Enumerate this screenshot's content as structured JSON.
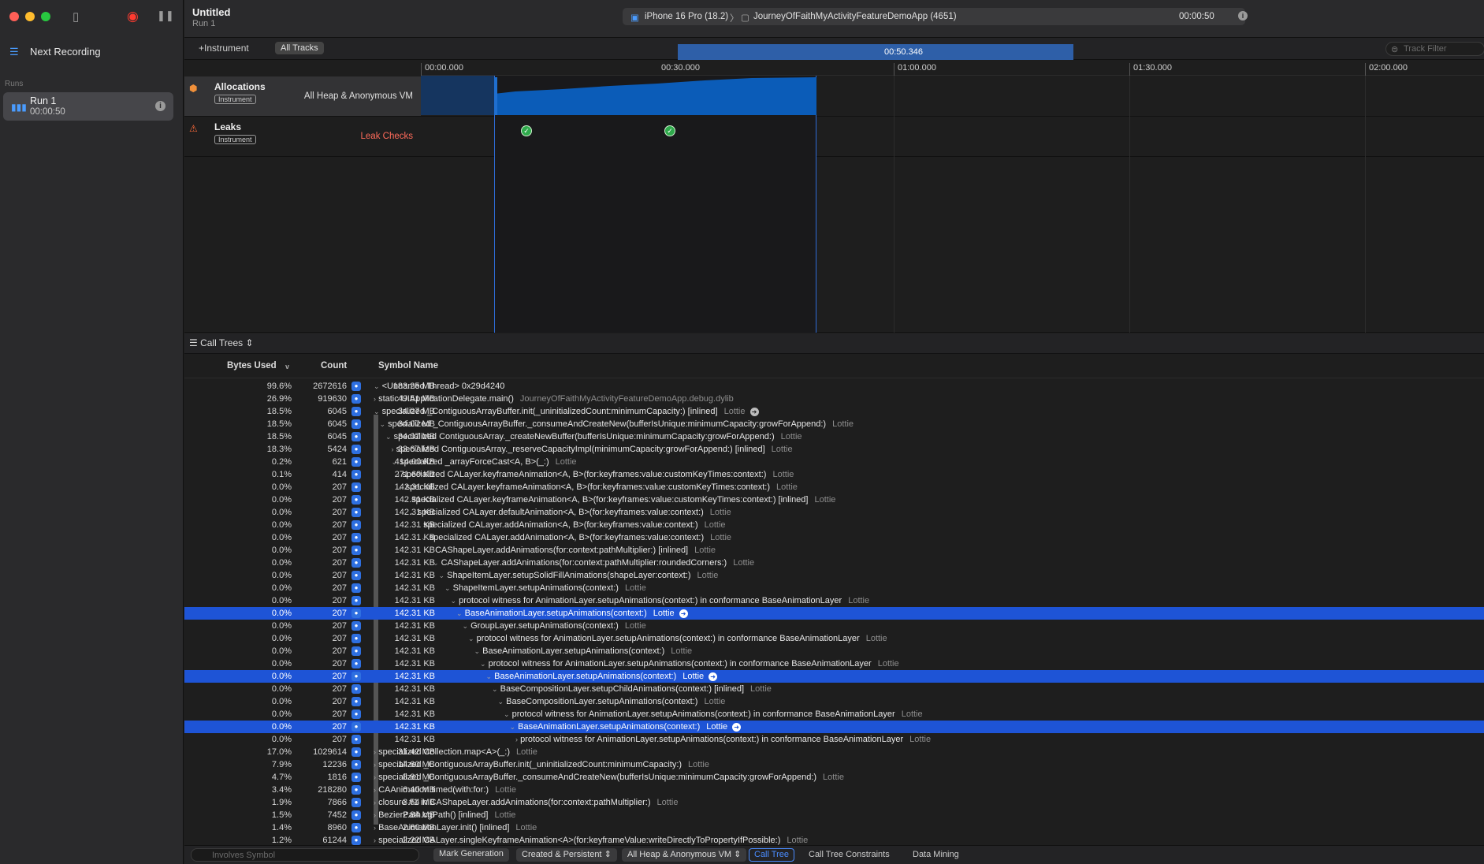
{
  "window": {
    "title": "Untitled",
    "subtitle": "Run 1"
  },
  "sidebar": {
    "next_recording": "Next Recording",
    "runs_label": "Runs",
    "run": {
      "title": "Run 1",
      "duration": "00:00:50"
    }
  },
  "target": {
    "device": "iPhone 16 Pro (18.2)",
    "app": "JourneyOfFaithMyActivityFeatureDemoApp (4651)",
    "timer": "00:00:50"
  },
  "toolbar": {
    "add_instrument": "+Instrument",
    "all_tracks": "All Tracks",
    "track_filter_placeholder": "Track Filter"
  },
  "ruler": {
    "ticks": [
      "00:00.000",
      "00:30.000",
      "01:00.000",
      "01:30.000",
      "02:00.000"
    ],
    "selection_end": "00:50.346"
  },
  "tracks": [
    {
      "name": "Allocations",
      "badge": "Instrument",
      "right_label": "All Heap & Anonymous VM",
      "right_color": "#e0e0e0"
    },
    {
      "name": "Leaks",
      "badge": "Instrument",
      "right_label": "Leak Checks",
      "right_color": "#ff6b5a"
    }
  ],
  "calltree": {
    "view_menu": "Call Trees",
    "columns": {
      "bytes": "Bytes Used",
      "count": "Count",
      "symbol": "Symbol Name"
    },
    "rows": [
      {
        "bytes": "183.25 MB",
        "pct": "99.6%",
        "count": "2672616",
        "indent": 0,
        "arrow": "v",
        "symbol": "<Unnamed Thread> 0x29d4240",
        "lib": "",
        "sel": false,
        "go": false
      },
      {
        "bytes": "49.51 MB",
        "pct": "26.9%",
        "count": "919630",
        "indent": 0,
        "arrow": ">",
        "symbol": "static UIApplicationDelegate.main()",
        "lib": "JourneyOfFaithMyActivityFeatureDemoApp.debug.dylib",
        "sel": false,
        "go": false
      },
      {
        "bytes": "34.07 MB",
        "pct": "18.5%",
        "count": "6045",
        "indent": 0,
        "arrow": "v",
        "symbol": "specialized _ContiguousArrayBuffer.init(_uninitializedCount:minimumCapacity:) [inlined]",
        "lib": "Lottie",
        "sel": false,
        "go": true
      },
      {
        "bytes": "34.07 MB",
        "pct": "18.5%",
        "count": "6045",
        "indent": 1,
        "arrow": "v",
        "symbol": "specialized _ContiguousArrayBuffer._consumeAndCreateNew(bufferIsUnique:minimumCapacity:growForAppend:)",
        "lib": "Lottie",
        "sel": false,
        "go": false
      },
      {
        "bytes": "34.07 MB",
        "pct": "18.5%",
        "count": "6045",
        "indent": 2,
        "arrow": "v",
        "symbol": "specialized ContiguousArray._createNewBuffer(bufferIsUnique:minimumCapacity:growForAppend:)",
        "lib": "Lottie",
        "sel": false,
        "go": false
      },
      {
        "bytes": "33.67 MB",
        "pct": "18.3%",
        "count": "5424",
        "indent": 3,
        "arrow": ">",
        "symbol": "specialized ContiguousArray._reserveCapacityImpl(minimumCapacity:growForAppend:) [inlined]",
        "lib": "Lottie",
        "sel": false,
        "go": false
      },
      {
        "bytes": "414.00 KB",
        "pct": "0.2%",
        "count": "621",
        "indent": 3,
        "arrow": "v",
        "symbol": "specialized _arrayForceCast<A, B>(_:)",
        "lib": "Lottie",
        "sel": false,
        "go": false
      },
      {
        "bytes": "271.69 KB",
        "pct": "0.1%",
        "count": "414",
        "indent": 4,
        "arrow": ">",
        "symbol": "specialized CALayer.keyframeAnimation<A, B>(for:keyframes:value:customKeyTimes:context:)",
        "lib": "Lottie",
        "sel": false,
        "go": false
      },
      {
        "bytes": "142.31 KB",
        "pct": "0.0%",
        "count": "207",
        "indent": 4,
        "arrow": "v",
        "symbol": "specialized CALayer.keyframeAnimation<A, B>(for:keyframes:value:customKeyTimes:context:)",
        "lib": "Lottie",
        "sel": false,
        "go": false
      },
      {
        "bytes": "142.31 KB",
        "pct": "0.0%",
        "count": "207",
        "indent": 5,
        "arrow": "v",
        "symbol": "specialized CALayer.keyframeAnimation<A, B>(for:keyframes:value:customKeyTimes:context:) [inlined]",
        "lib": "Lottie",
        "sel": false,
        "go": false
      },
      {
        "bytes": "142.31 KB",
        "pct": "0.0%",
        "count": "207",
        "indent": 6,
        "arrow": "v",
        "symbol": "specialized CALayer.defaultAnimation<A, B>(for:keyframes:value:context:)",
        "lib": "Lottie",
        "sel": false,
        "go": false
      },
      {
        "bytes": "142.31 KB",
        "pct": "0.0%",
        "count": "207",
        "indent": 7,
        "arrow": "v",
        "symbol": "specialized CALayer.addAnimation<A, B>(for:keyframes:value:context:)",
        "lib": "Lottie",
        "sel": false,
        "go": false
      },
      {
        "bytes": "142.31 KB",
        "pct": "0.0%",
        "count": "207",
        "indent": 8,
        "arrow": "v",
        "symbol": "specialized CALayer.addAnimation<A, B>(for:keyframes:value:context:)",
        "lib": "Lottie",
        "sel": false,
        "go": false
      },
      {
        "bytes": "142.31 KB",
        "pct": "0.0%",
        "count": "207",
        "indent": 9,
        "arrow": "v",
        "symbol": "CAShapeLayer.addAnimations(for:context:pathMultiplier:) [inlined]",
        "lib": "Lottie",
        "sel": false,
        "go": false
      },
      {
        "bytes": "142.31 KB",
        "pct": "0.0%",
        "count": "207",
        "indent": 10,
        "arrow": "v",
        "symbol": "CAShapeLayer.addAnimations(for:context:pathMultiplier:roundedCorners:)",
        "lib": "Lottie",
        "sel": false,
        "go": false
      },
      {
        "bytes": "142.31 KB",
        "pct": "0.0%",
        "count": "207",
        "indent": 11,
        "arrow": "v",
        "symbol": "ShapeItemLayer.setupSolidFillAnimations(shapeLayer:context:)",
        "lib": "Lottie",
        "sel": false,
        "go": false
      },
      {
        "bytes": "142.31 KB",
        "pct": "0.0%",
        "count": "207",
        "indent": 12,
        "arrow": "v",
        "symbol": "ShapeItemLayer.setupAnimations(context:)",
        "lib": "Lottie",
        "sel": false,
        "go": false
      },
      {
        "bytes": "142.31 KB",
        "pct": "0.0%",
        "count": "207",
        "indent": 13,
        "arrow": "v",
        "symbol": "protocol witness for AnimationLayer.setupAnimations(context:) in conformance BaseAnimationLayer",
        "lib": "Lottie",
        "sel": false,
        "go": false
      },
      {
        "bytes": "142.31 KB",
        "pct": "0.0%",
        "count": "207",
        "indent": 14,
        "arrow": "v",
        "symbol": "BaseAnimationLayer.setupAnimations(context:)",
        "lib": "Lottie",
        "sel": true,
        "go": true
      },
      {
        "bytes": "142.31 KB",
        "pct": "0.0%",
        "count": "207",
        "indent": 15,
        "arrow": "v",
        "symbol": "GroupLayer.setupAnimations(context:)",
        "lib": "Lottie",
        "sel": false,
        "go": false
      },
      {
        "bytes": "142.31 KB",
        "pct": "0.0%",
        "count": "207",
        "indent": 16,
        "arrow": "v",
        "symbol": "protocol witness for AnimationLayer.setupAnimations(context:) in conformance BaseAnimationLayer",
        "lib": "Lottie",
        "sel": false,
        "go": false
      },
      {
        "bytes": "142.31 KB",
        "pct": "0.0%",
        "count": "207",
        "indent": 17,
        "arrow": "v",
        "symbol": "BaseAnimationLayer.setupAnimations(context:)",
        "lib": "Lottie",
        "sel": false,
        "go": false
      },
      {
        "bytes": "142.31 KB",
        "pct": "0.0%",
        "count": "207",
        "indent": 18,
        "arrow": "v",
        "symbol": "protocol witness for AnimationLayer.setupAnimations(context:) in conformance BaseAnimationLayer",
        "lib": "Lottie",
        "sel": false,
        "go": false
      },
      {
        "bytes": "142.31 KB",
        "pct": "0.0%",
        "count": "207",
        "indent": 19,
        "arrow": "v",
        "symbol": "BaseAnimationLayer.setupAnimations(context:)",
        "lib": "Lottie",
        "sel": true,
        "go": true
      },
      {
        "bytes": "142.31 KB",
        "pct": "0.0%",
        "count": "207",
        "indent": 20,
        "arrow": "v",
        "symbol": "BaseCompositionLayer.setupChildAnimations(context:) [inlined]",
        "lib": "Lottie",
        "sel": false,
        "go": false
      },
      {
        "bytes": "142.31 KB",
        "pct": "0.0%",
        "count": "207",
        "indent": 21,
        "arrow": "v",
        "symbol": "BaseCompositionLayer.setupAnimations(context:)",
        "lib": "Lottie",
        "sel": false,
        "go": false
      },
      {
        "bytes": "142.31 KB",
        "pct": "0.0%",
        "count": "207",
        "indent": 22,
        "arrow": "v",
        "symbol": "protocol witness for AnimationLayer.setupAnimations(context:) in conformance BaseAnimationLayer",
        "lib": "Lottie",
        "sel": false,
        "go": false
      },
      {
        "bytes": "142.31 KB",
        "pct": "0.0%",
        "count": "207",
        "indent": 23,
        "arrow": "v",
        "symbol": "BaseAnimationLayer.setupAnimations(context:)",
        "lib": "Lottie",
        "sel": true,
        "go": true
      },
      {
        "bytes": "142.31 KB",
        "pct": "0.0%",
        "count": "207",
        "indent": 24,
        "arrow": ">",
        "symbol": "protocol witness for AnimationLayer.setupAnimations(context:) in conformance BaseAnimationLayer",
        "lib": "Lottie",
        "sel": false,
        "go": false
      },
      {
        "bytes": "31.42 MB",
        "pct": "17.0%",
        "count": "1029614",
        "indent": 0,
        "arrow": ">",
        "symbol": "specialized Collection.map<A>(_:)",
        "lib": "Lottie",
        "sel": false,
        "go": false
      },
      {
        "bytes": "14.60 MB",
        "pct": "7.9%",
        "count": "12236",
        "indent": 0,
        "arrow": ">",
        "symbol": "specialized _ContiguousArrayBuffer.init(_uninitializedCount:minimumCapacity:)",
        "lib": "Lottie",
        "sel": false,
        "go": false
      },
      {
        "bytes": "8.81 MB",
        "pct": "4.7%",
        "count": "1816",
        "indent": 0,
        "arrow": ">",
        "symbol": "specialized _ContiguousArrayBuffer._consumeAndCreateNew(bufferIsUnique:minimumCapacity:growForAppend:)",
        "lib": "Lottie",
        "sel": false,
        "go": false
      },
      {
        "bytes": "6.40 MB",
        "pct": "3.4%",
        "count": "218280",
        "indent": 0,
        "arrow": ">",
        "symbol": "CAAnimation.timed(with:for:)",
        "lib": "Lottie",
        "sel": false,
        "go": false
      },
      {
        "bytes": "3.54 MB",
        "pct": "1.9%",
        "count": "7866",
        "indent": 0,
        "arrow": ">",
        "symbol": "closure #1 in CAShapeLayer.addAnimations(for:context:pathMultiplier:)",
        "lib": "Lottie",
        "sel": false,
        "go": false
      },
      {
        "bytes": "2.84 MB",
        "pct": "1.5%",
        "count": "7452",
        "indent": 0,
        "arrow": ">",
        "symbol": "BezierPath.cgPath() [inlined]",
        "lib": "Lottie",
        "sel": false,
        "go": false
      },
      {
        "bytes": "2.60 MB",
        "pct": "1.4%",
        "count": "8960",
        "indent": 0,
        "arrow": ">",
        "symbol": "BaseAnimationLayer.init() [inlined]",
        "lib": "Lottie",
        "sel": false,
        "go": false
      },
      {
        "bytes": "2.22 MB",
        "pct": "1.2%",
        "count": "61244",
        "indent": 0,
        "arrow": ">",
        "symbol": "specialized CALayer.singleKeyframeAnimation<A>(for:keyframeValue:writeDirectlyToPropertyIfPossible:)",
        "lib": "Lottie",
        "sel": false,
        "go": false
      }
    ]
  },
  "bottombar": {
    "involves_placeholder": "Involves Symbol",
    "mark_generation": "Mark Generation",
    "lifespan": "Created & Persistent",
    "allocation_type": "All Heap & Anonymous VM",
    "call_tree": "Call Tree",
    "call_tree_constraints": "Call Tree Constraints",
    "data_mining": "Data Mining"
  },
  "colors": {
    "accent": "#1e54d6",
    "selection_region": "#2e5fa8",
    "graph_fill": "#0b5cb8"
  }
}
